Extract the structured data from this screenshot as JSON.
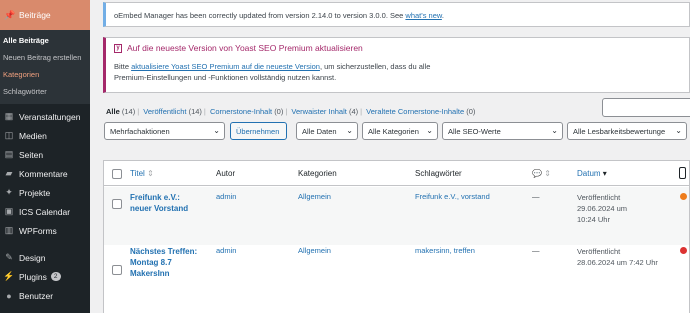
{
  "sidebar": {
    "active": {
      "icon": "pin-icon",
      "label": "Beiträge"
    },
    "submenu": [
      "Alle Beiträge",
      "Neuen Beitrag erstellen",
      "Kategorien",
      "Schlagwörter"
    ],
    "items": [
      {
        "icon": "calendar-icon",
        "label": "Veranstaltungen"
      },
      {
        "icon": "media-icon",
        "label": "Medien"
      },
      {
        "icon": "pages-icon",
        "label": "Seiten"
      },
      {
        "icon": "comments-icon",
        "label": "Kommentare"
      },
      {
        "icon": "pin-icon",
        "label": "Projekte"
      },
      {
        "icon": "ics-icon",
        "label": "ICS Calendar"
      },
      {
        "icon": "forms-icon",
        "label": "WPForms"
      },
      {
        "icon": "brush-icon",
        "label": "Design"
      },
      {
        "icon": "plugin-icon",
        "label": "Plugins",
        "badge": "2"
      },
      {
        "icon": "user-icon",
        "label": "Benutzer"
      }
    ]
  },
  "notices": {
    "oembed": {
      "text": "oEmbed Manager has been correctly updated from version 2.14.0 to version 3.0.0. See ",
      "link": "what's new",
      "end": "."
    },
    "yoast": {
      "logo": "y",
      "title": "Auf die neueste Version von Yoast SEO Premium aktualisieren",
      "body_pre": "Bitte ",
      "body_link": "aktualisiere Yoast SEO Premium auf die neueste Version",
      "body_post": ", um sicherzustellen, dass du alle",
      "body_line2": "Premium-Einstellungen und -Funktionen vollständig nutzen kannst."
    }
  },
  "views": [
    {
      "label": "Alle",
      "count": "(14)"
    },
    {
      "label": "Veröffentlicht",
      "count": "(14)"
    },
    {
      "label": "Cornerstone-Inhalt",
      "count": "(0)"
    },
    {
      "label": "Verwaister Inhalt",
      "count": "(4)"
    },
    {
      "label": "Veraltete Cornerstone-Inhalte",
      "count": "(0)"
    }
  ],
  "filters": {
    "bulk": "Mehrfachaktionen",
    "apply": "Übernehmen",
    "dates": "Alle Daten",
    "categories": "Alle Kategorien",
    "seo": "Alle SEO-Werte",
    "readability": "Alle Lesbarkeitsbewertunge"
  },
  "table": {
    "headers": {
      "title": "Titel",
      "author": "Autor",
      "categories": "Kategorien",
      "tags": "Schlagwörter",
      "date": "Datum"
    },
    "rows": [
      {
        "title_l1": "Freifunk e.V.:",
        "title_l2": "neuer Vorstand",
        "author": "admin",
        "category": "Allgemein",
        "tags": "Freifunk e.V., vorstand",
        "comments": "—",
        "status": "Veröffentlicht",
        "date_l1": "29.06.2024 um",
        "date_l2": "10:24 Uhr",
        "dot_color": "#ee7c1b"
      },
      {
        "title_l1": "Nächstes Treffen:",
        "title_l2": "Montag 8.7",
        "title_l3": "MakersInn",
        "author": "admin",
        "category": "Allgemein",
        "tags": "makersinn, treffen",
        "comments": "—",
        "status": "Veröffentlicht",
        "date_l1": "28.06.2024 um 7:42 Uhr",
        "dot_color": "#dc3232"
      }
    ]
  }
}
